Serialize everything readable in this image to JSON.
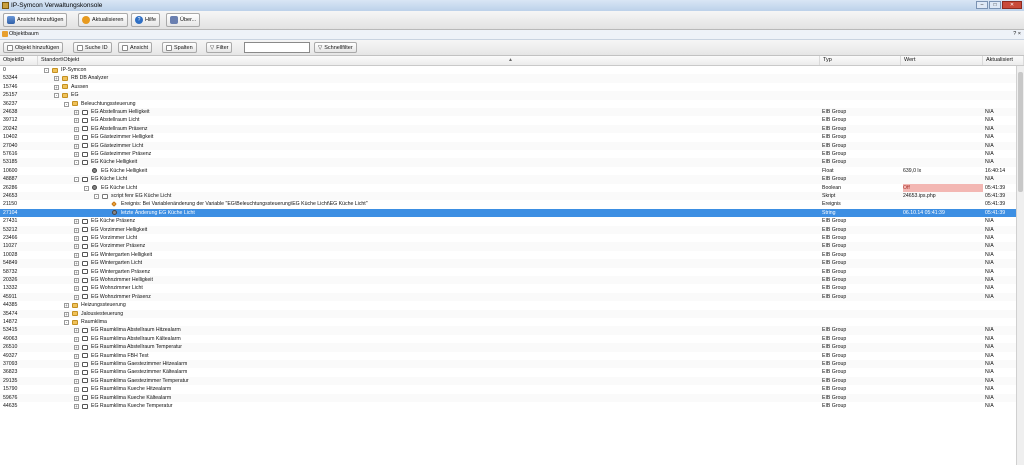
{
  "window": {
    "title": "IP-Symcon Verwaltungskonsole",
    "controls": [
      "–",
      "□",
      "✕"
    ]
  },
  "main_toolbar": {
    "buttons": [
      {
        "label": "Ansicht hinzufügen",
        "icon": "window-icon"
      },
      {
        "label": "Aktualisieren",
        "icon": "refresh-icon"
      },
      {
        "label": "Hilfe",
        "icon": "help-icon"
      },
      {
        "label": "Über...",
        "icon": "about-icon"
      }
    ]
  },
  "panel": {
    "title": "Objektbaum",
    "right_controls": "? ×"
  },
  "tree_toolbar": {
    "buttons": [
      "Objekt hinzufügen",
      "Suche ID",
      "Ansicht",
      "Spalten",
      "Filter"
    ],
    "search_value": "",
    "quickfilter_label": "Schnellfilter"
  },
  "columns": {
    "id": "ObjektID",
    "name": "Standort\\Objekt",
    "type": "Typ",
    "value": "Wert",
    "updated": "Aktualisiert"
  },
  "colors": {
    "selection": "#3d8fe3",
    "warning_bg": "#f3b7b3",
    "folder": "#f0c25a"
  },
  "rows": [
    {
      "id": "0",
      "name": "IP-Symcon",
      "level": 0,
      "icon": "root",
      "exp": "-",
      "type": "",
      "value": "",
      "updated": ""
    },
    {
      "id": "53344",
      "name": "RB DB Analyzer",
      "level": 1,
      "icon": "folder",
      "exp": "+",
      "type": "",
      "value": "",
      "updated": ""
    },
    {
      "id": "15746",
      "name": "Aussen",
      "level": 1,
      "icon": "folder",
      "exp": "+",
      "type": "",
      "value": "",
      "updated": ""
    },
    {
      "id": "25157",
      "name": "EG",
      "level": 1,
      "icon": "folder",
      "exp": "-",
      "type": "",
      "value": "",
      "updated": ""
    },
    {
      "id": "36237",
      "name": "Beleuchtungssteuerung",
      "level": 2,
      "icon": "folder",
      "exp": "-",
      "type": "",
      "value": "",
      "updated": ""
    },
    {
      "id": "24638",
      "name": "EG Abstellraum Helligkeit",
      "level": 3,
      "icon": "instance",
      "exp": "+",
      "type": "EIB Group",
      "value": "",
      "updated": "N/A"
    },
    {
      "id": "39712",
      "name": "EG Abstellraum Licht",
      "level": 3,
      "icon": "instance",
      "exp": "+",
      "type": "EIB Group",
      "value": "",
      "updated": "N/A"
    },
    {
      "id": "20242",
      "name": "EG Abstellraum Präsenz",
      "level": 3,
      "icon": "instance",
      "exp": "+",
      "type": "EIB Group",
      "value": "",
      "updated": "N/A"
    },
    {
      "id": "10402",
      "name": "EG Gästezimmer Helligkeit",
      "level": 3,
      "icon": "instance",
      "exp": "+",
      "type": "EIB Group",
      "value": "",
      "updated": "N/A"
    },
    {
      "id": "27040",
      "name": "EG Gästezimmer Licht",
      "level": 3,
      "icon": "instance",
      "exp": "+",
      "type": "EIB Group",
      "value": "",
      "updated": "N/A"
    },
    {
      "id": "57616",
      "name": "EG Gästezimmer Präsenz",
      "level": 3,
      "icon": "instance",
      "exp": "+",
      "type": "EIB Group",
      "value": "",
      "updated": "N/A"
    },
    {
      "id": "53185",
      "name": "EG Küche Helligkeit",
      "level": 3,
      "icon": "instance",
      "exp": "-",
      "type": "EIB Group",
      "value": "",
      "updated": "N/A"
    },
    {
      "id": "10600",
      "name": "EG Küche Helligkeit",
      "level": 4,
      "icon": "variable",
      "exp": "",
      "type": "Float",
      "value": "639,0 lx",
      "updated": "16:40:14"
    },
    {
      "id": "48887",
      "name": "EG Küche Licht",
      "level": 3,
      "icon": "instance",
      "exp": "-",
      "type": "EIB Group",
      "value": "",
      "updated": "N/A"
    },
    {
      "id": "26286",
      "name": "EG Küche Licht",
      "level": 4,
      "icon": "variable",
      "exp": "-",
      "type": "Boolean",
      "value": "Off",
      "updated": "05:41:39",
      "warn": true
    },
    {
      "id": "24653",
      "name": "script fenr EG Küche Licht",
      "level": 5,
      "icon": "script",
      "exp": "-",
      "type": "Skript",
      "value": "24653.ips.php",
      "updated": "05:41:39"
    },
    {
      "id": "21150",
      "name": "Ereignis: Bei Variablenänderung der Variable \"EG\\Beleuchtungssteuerung\\EG Küche Licht\\EG Küche Licht\"",
      "level": 6,
      "icon": "event",
      "exp": "",
      "type": "Ereignis",
      "value": "",
      "updated": "05:41:39"
    },
    {
      "id": "27104",
      "name": "letzte Änderung EG Küche Licht",
      "level": 6,
      "icon": "variable",
      "exp": "",
      "type": "String",
      "value": "06.10.14 05:41:39",
      "updated": "05:41:39",
      "selected": true
    },
    {
      "id": "27431",
      "name": "EG Küche Präsenz",
      "level": 3,
      "icon": "instance",
      "exp": "+",
      "type": "EIB Group",
      "value": "",
      "updated": "N/A"
    },
    {
      "id": "53212",
      "name": "EG Vorzimmer Helligkeit",
      "level": 3,
      "icon": "instance",
      "exp": "+",
      "type": "EIB Group",
      "value": "",
      "updated": "N/A"
    },
    {
      "id": "23466",
      "name": "EG Vorzimmer Licht",
      "level": 3,
      "icon": "instance",
      "exp": "+",
      "type": "EIB Group",
      "value": "",
      "updated": "N/A"
    },
    {
      "id": "11027",
      "name": "EG Vorzimmer Präsenz",
      "level": 3,
      "icon": "instance",
      "exp": "+",
      "type": "EIB Group",
      "value": "",
      "updated": "N/A"
    },
    {
      "id": "10028",
      "name": "EG Wintergarten Helligkeit",
      "level": 3,
      "icon": "instance",
      "exp": "+",
      "type": "EIB Group",
      "value": "",
      "updated": "N/A"
    },
    {
      "id": "54849",
      "name": "EG Wintergarten Licht",
      "level": 3,
      "icon": "instance",
      "exp": "+",
      "type": "EIB Group",
      "value": "",
      "updated": "N/A"
    },
    {
      "id": "58732",
      "name": "EG Wintergarten Präsenz",
      "level": 3,
      "icon": "instance",
      "exp": "+",
      "type": "EIB Group",
      "value": "",
      "updated": "N/A"
    },
    {
      "id": "20326",
      "name": "EG Wohnzimmer Helligkeit",
      "level": 3,
      "icon": "instance",
      "exp": "+",
      "type": "EIB Group",
      "value": "",
      "updated": "N/A"
    },
    {
      "id": "13332",
      "name": "EG Wohnzimmer Licht",
      "level": 3,
      "icon": "instance",
      "exp": "+",
      "type": "EIB Group",
      "value": "",
      "updated": "N/A"
    },
    {
      "id": "45911",
      "name": "EG Wohnzimmer Präsenz",
      "level": 3,
      "icon": "instance",
      "exp": "+",
      "type": "EIB Group",
      "value": "",
      "updated": "N/A"
    },
    {
      "id": "44385",
      "name": "Heizungssteuerung",
      "level": 2,
      "icon": "folder",
      "exp": "+",
      "type": "",
      "value": "",
      "updated": ""
    },
    {
      "id": "35474",
      "name": "Jalousiesteuerung",
      "level": 2,
      "icon": "folder",
      "exp": "+",
      "type": "",
      "value": "",
      "updated": ""
    },
    {
      "id": "14872",
      "name": "Raumklima",
      "level": 2,
      "icon": "folder",
      "exp": "-",
      "type": "",
      "value": "",
      "updated": ""
    },
    {
      "id": "53415",
      "name": "EG Raumklima Abstellraum Hitzealarm",
      "level": 3,
      "icon": "instance",
      "exp": "+",
      "type": "EIB Group",
      "value": "",
      "updated": "N/A"
    },
    {
      "id": "49063",
      "name": "EG Raumklima Abstellraum Kältealarm",
      "level": 3,
      "icon": "instance",
      "exp": "+",
      "type": "EIB Group",
      "value": "",
      "updated": "N/A"
    },
    {
      "id": "26510",
      "name": "EG Raumklima Abstellraum Temperatur",
      "level": 3,
      "icon": "instance",
      "exp": "+",
      "type": "EIB Group",
      "value": "",
      "updated": "N/A"
    },
    {
      "id": "49327",
      "name": "EG Raumklima FBH Test",
      "level": 3,
      "icon": "instance",
      "exp": "+",
      "type": "EIB Group",
      "value": "",
      "updated": "N/A"
    },
    {
      "id": "37093",
      "name": "EG Raumklima Gaestezimmer Hitzealarm",
      "level": 3,
      "icon": "instance",
      "exp": "+",
      "type": "EIB Group",
      "value": "",
      "updated": "N/A"
    },
    {
      "id": "36823",
      "name": "EG Raumklima Gaestezimmer Kältealarm",
      "level": 3,
      "icon": "instance",
      "exp": "+",
      "type": "EIB Group",
      "value": "",
      "updated": "N/A"
    },
    {
      "id": "29135",
      "name": "EG Raumklima Gaestezimmer Temperatur",
      "level": 3,
      "icon": "instance",
      "exp": "+",
      "type": "EIB Group",
      "value": "",
      "updated": "N/A"
    },
    {
      "id": "15790",
      "name": "EG Raumklima Kueche Hitzealarm",
      "level": 3,
      "icon": "instance",
      "exp": "+",
      "type": "EIB Group",
      "value": "",
      "updated": "N/A"
    },
    {
      "id": "59676",
      "name": "EG Raumklima Kueche Kältealarm",
      "level": 3,
      "icon": "instance",
      "exp": "+",
      "type": "EIB Group",
      "value": "",
      "updated": "N/A"
    },
    {
      "id": "44635",
      "name": "EG Raumklima Kueche Temperatur",
      "level": 3,
      "icon": "instance",
      "exp": "+",
      "type": "EIB Group",
      "value": "",
      "updated": "N/A"
    }
  ]
}
